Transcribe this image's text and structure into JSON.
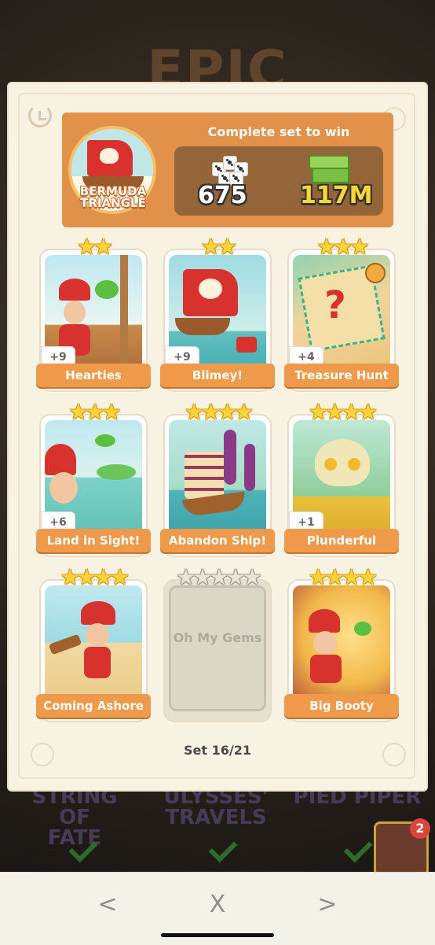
{
  "background": {
    "title": "EPIC",
    "other_sets": [
      {
        "name_line1": "STRING OF",
        "name_line2": "FATE"
      },
      {
        "name_line1": "ULYSSES'",
        "name_line2": "TRAVELS"
      },
      {
        "name_line1": "PIED PIPER",
        "name_line2": ""
      }
    ],
    "album_badge": "2"
  },
  "header": {
    "set_name_line1": "BERMUDA",
    "set_name_line2": "TRIANGLE",
    "complete_text": "Complete set to win",
    "reward_dice": "675",
    "reward_cash": "117M"
  },
  "stickers": [
    {
      "name": "Hearties",
      "stars": 2,
      "duplicates": "+9",
      "collected": true
    },
    {
      "name": "Blimey!",
      "stars": 2,
      "duplicates": "+9",
      "collected": true
    },
    {
      "name": "Treasure Hunt",
      "stars": 3,
      "duplicates": "+4",
      "collected": true
    },
    {
      "name": "Land in Sight!",
      "stars": 3,
      "duplicates": "+6",
      "collected": true
    },
    {
      "name": "Abandon Ship!",
      "stars": 4,
      "duplicates": "",
      "collected": true
    },
    {
      "name": "Plunderful",
      "stars": 4,
      "duplicates": "+1",
      "collected": true
    },
    {
      "name": "Coming Ashore",
      "stars": 4,
      "duplicates": "",
      "collected": true
    },
    {
      "name": "Oh My Gems",
      "stars": 5,
      "duplicates": "",
      "collected": false
    },
    {
      "name": "Big Booty",
      "stars": 4,
      "duplicates": "",
      "collected": true
    }
  ],
  "set_count": "Set 16/21",
  "nav": {
    "prev": "<",
    "close": "X",
    "next": ">"
  },
  "colors": {
    "header_bg": "#e2914b",
    "reward_bg": "#95653a",
    "label_bg": "#ef9a4a",
    "star": "#ffd43b"
  }
}
